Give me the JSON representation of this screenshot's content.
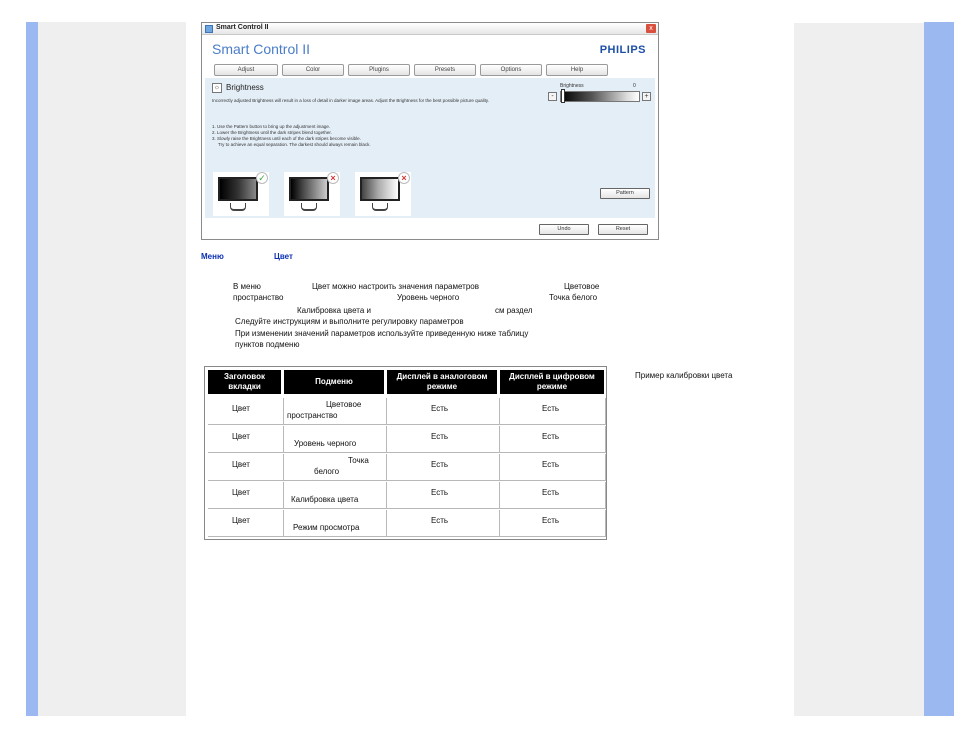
{
  "window": {
    "title": "Smart Control II",
    "brand": "Smart Control II",
    "logo": "PHILIPS",
    "close": "x",
    "tabs": [
      "Adjust",
      "Color",
      "Plugins",
      "Presets",
      "Options",
      "Help"
    ],
    "section_title": "Brightness",
    "description": "Incorrectly adjusted Brightness will result in a loss of detail in darker image areas. Adjust the Brightness for the best possible picture quality.",
    "steps": [
      "1. Use the Pattern button to bring up the adjustment image.",
      "2. Lower the Brightness until the dark stripes blend together.",
      "3. Slowly raise the Brightness until each of the dark stripes become visible.",
      "Try to achieve an equal separation. The darkest should always remain black."
    ],
    "slider": {
      "label": "Brightness",
      "value": "0",
      "minus": "-",
      "plus": "+"
    },
    "marks": {
      "ok": "✓",
      "bad": "×"
    },
    "buttons": {
      "pattern": "Pattern",
      "undo": "Undo",
      "reset": "Reset"
    }
  },
  "doc": {
    "menu_label": "Меню",
    "menu_value": "Цвет",
    "para": {
      "l1a": "В меню",
      "l1b": "Цвет  можно настроить значения параметров",
      "l1c": "Цветовое",
      "l2a": "пространство",
      "l2b": "Уровень черного",
      "l2c": "Точка белого",
      "l3a": "Калибровка цвета  и",
      "l3b": "см  раздел",
      "l4": "Следуйте инструкциям и выполните регулировку параметров",
      "l5": "При изменении значений параметров используйте приведенную ниже таблицу",
      "l6": "пунктов подменю"
    },
    "table": {
      "headers": [
        "Заголовок вкладки",
        "Подменю",
        "Дисплей в аналоговом режиме",
        "Дисплей в цифровом режиме"
      ],
      "rows": [
        [
          "Цвет",
          "Цветовое пространство",
          "Есть",
          "Есть"
        ],
        [
          "Цвет",
          "Уровень черного",
          "Есть",
          "Есть"
        ],
        [
          "Цвет",
          "Точка белого",
          "Есть",
          "Есть"
        ],
        [
          "Цвет",
          "Калибровка цвета",
          "Есть",
          "Есть"
        ],
        [
          "Цвет",
          "Режим просмотра",
          "Есть",
          "Есть"
        ]
      ]
    },
    "side_note": "Пример калибровки цвета"
  }
}
